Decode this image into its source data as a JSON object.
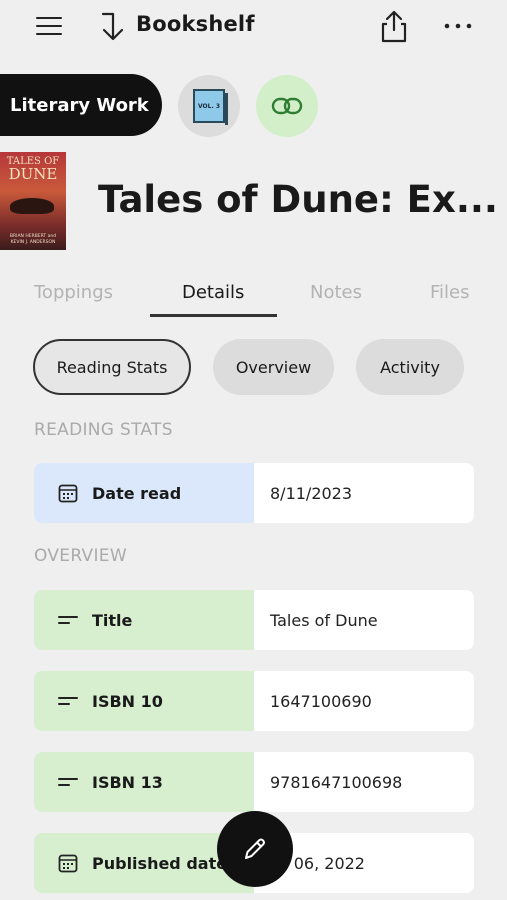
{
  "header": {
    "title": "Bookshelf"
  },
  "chips": {
    "type_label": "Literary Work",
    "volume_badge": "VOL. 3"
  },
  "book": {
    "title": "Tales of Dune: Ex...",
    "cover": {
      "title_line1": "TALES OF",
      "title_line2": "DUNE",
      "authors": "BRIAN HERBERT and KEVIN J. ANDERSON"
    }
  },
  "tabs": [
    {
      "label": "Toppings"
    },
    {
      "label": "Details"
    },
    {
      "label": "Notes"
    },
    {
      "label": "Files"
    }
  ],
  "active_tab": "Details",
  "pills": [
    {
      "label": "Reading Stats"
    },
    {
      "label": "Overview"
    },
    {
      "label": "Activity"
    }
  ],
  "sections": {
    "reading_stats": {
      "label": "READING STATS",
      "fields": [
        {
          "key": "Date read",
          "value": "8/11/2023",
          "icon": "calendar-icon"
        }
      ]
    },
    "overview": {
      "label": "OVERVIEW",
      "fields": [
        {
          "key": "Title",
          "value": "Tales of Dune",
          "icon": "text-lines-icon"
        },
        {
          "key": "ISBN 10",
          "value": "1647100690",
          "icon": "text-lines-icon"
        },
        {
          "key": "ISBN 13",
          "value": "9781647100698",
          "icon": "text-lines-icon"
        },
        {
          "key": "Published date",
          "value": "ec 06, 2022",
          "icon": "calendar-icon"
        }
      ]
    }
  },
  "colors": {
    "reading_key_bg": "#dbe8fb",
    "overview_key_bg": "#d7efcf",
    "link_chip_bg": "#d2efc9",
    "fab_bg": "#111111"
  }
}
